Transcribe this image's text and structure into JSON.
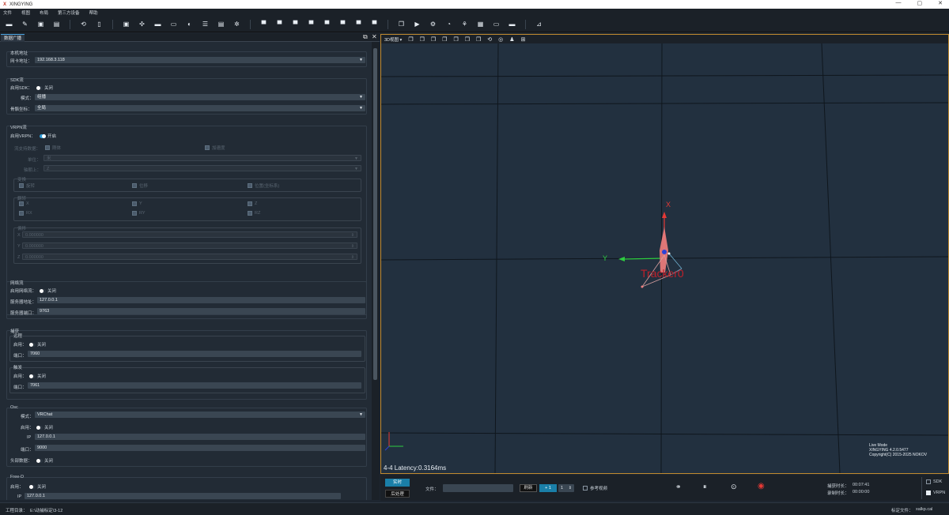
{
  "window": {
    "logo": "X",
    "title": "XINGYING",
    "min": "—",
    "max": "▢",
    "close": "✕"
  },
  "menu": [
    "文件",
    "视图",
    "布局",
    "第三方设备",
    "帮助"
  ],
  "panel": {
    "tab": "数据广播",
    "float": "⧉",
    "close": "✕"
  },
  "host": {
    "title": "本机地址",
    "label": "网卡地址：",
    "value": "192.168.3.118"
  },
  "sdk": {
    "title": "SDK流",
    "enable_label": "启用SDK：",
    "enable_state": "关闭",
    "mode_label": "模式：",
    "mode_value": "组播",
    "skeleton_label": "骨骼坐标：",
    "skeleton_value": "全局"
  },
  "vrpn": {
    "title": "VRPN流",
    "enable_label": "启用VRPN：",
    "enable_state": "开启",
    "stream_label": "流支持数据：",
    "stream_opt1": "刚体",
    "stream_opt2": "加速度",
    "unit_label": "单位：",
    "unit_value": "米",
    "axis_label": "轴朝上：",
    "axis_value": "Z",
    "rot_title": "变换",
    "rot_opt1": "旋转",
    "rot_opt2": "位移",
    "rot_opt3": "位置(坐标系)",
    "mirror_title": "翻转",
    "mirror": [
      "X",
      "Y",
      "Z",
      "RX",
      "RY",
      "RZ"
    ],
    "offset_title": "偏移",
    "offset": [
      {
        "axis": "X",
        "value": "0.000000"
      },
      {
        "axis": "Y",
        "value": "0.000000"
      },
      {
        "axis": "Z",
        "value": "0.000000"
      }
    ]
  },
  "net": {
    "title": "网络流",
    "enable_label": "启用网络流：",
    "enable_state": "关闭",
    "addr_label": "服务器地址：",
    "addr_value": "127.0.0.1",
    "port_label": "服务器端口：",
    "port_value": "9763"
  },
  "capture": {
    "title": "捕获",
    "remote": {
      "title": "远程",
      "enable_label": "启用：",
      "enable_state": "关闭",
      "port_label": "端口：",
      "port_value": "7060"
    },
    "trigger": {
      "title": "触发",
      "enable_label": "启用：",
      "enable_state": "关闭",
      "port_label": "端口：",
      "port_value": "7061"
    }
  },
  "osc": {
    "title": "Osc",
    "mode_label": "模式：",
    "mode_value": "VRChat",
    "enable_label": "启用：",
    "enable_state": "关闭",
    "ip_label": "IP",
    "ip_value": "127.0.0.1",
    "port_label": "端口：",
    "port_value": "9000",
    "head_label": "头部数据：",
    "head_state": "关闭"
  },
  "freed": {
    "title": "Free-D",
    "enable_label": "启用：",
    "enable_state": "关闭",
    "ip_label": "IP",
    "ip_value": "127.0.0.1"
  },
  "viewport": {
    "view_label": "3D视图",
    "latency": "4-4 Latency:0.3164ms",
    "tracker_label": "Tracker0",
    "axis_x": "X",
    "axis_y": "Y",
    "live_mode": "Live Mode",
    "version": "XINGYING 4.2.0.5477",
    "copyright": "Copyright(C) 2015-2025 NOKOV",
    "colors": {
      "border": "#c18a2f",
      "tracker": "#e05a5a",
      "axis_x": "#e53935",
      "axis_y": "#2ecc40",
      "grid": "#0f161d"
    }
  },
  "bottom": {
    "realtime": "实时",
    "post": "后处理",
    "file_label": "文件：",
    "refresh": "刷新",
    "speed": "+ 1",
    "step": "1",
    "reference_label": "参考视频",
    "capture_time_label": "捕获时长：",
    "capture_time": "00:07:41",
    "record_time_label": "录制时长：",
    "record_time": "00:00:00",
    "sdk_check": "SDK",
    "vrpn_check": "VRPN"
  },
  "status": {
    "project_label": "工程目录：",
    "project_path": "E:\\动捕标定\\3-12",
    "calib_label": "标定文件：",
    "calib_file": "xalkp.cal"
  }
}
